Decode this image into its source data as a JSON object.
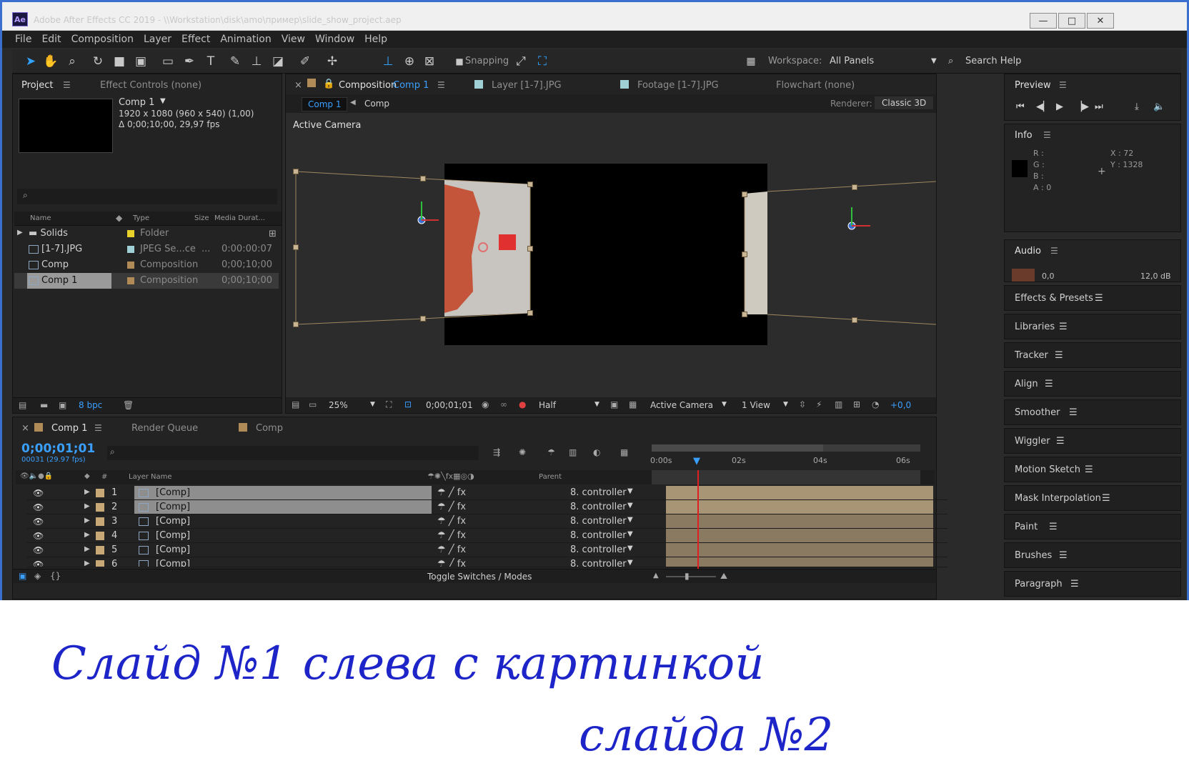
{
  "window": {
    "app_icon": "Ae",
    "title": "Adobe After Effects CC 2019 - \\\\Workstation\\disk\\amo\\пример\\slide_show_project.aep",
    "buttons": {
      "minimize": "—",
      "maximize": "□",
      "close": "✕"
    }
  },
  "menu": [
    "File",
    "Edit",
    "Composition",
    "Layer",
    "Effect",
    "Animation",
    "View",
    "Window",
    "Help"
  ],
  "toolbar": {
    "snapping_label": "Snapping",
    "workspace_label": "Workspace:",
    "workspace_value": "All Panels",
    "search_help": "Search Help"
  },
  "project_panel": {
    "tab_project": "Project",
    "tab_effect_controls": "Effect Controls (none)",
    "selected_name": "Comp 1",
    "selected_dims": "1920 x 1080  (960 x 540) (1,00)",
    "selected_duration": "Δ 0;00;10;00, 29,97 fps",
    "columns": {
      "name": "Name",
      "type": "Type",
      "size": "Size",
      "duration": "Media Durat..."
    },
    "items": [
      {
        "name": "Solids",
        "type": "Folder",
        "duration": "",
        "color": "#e8d12a"
      },
      {
        "name": "[1-7].JPG",
        "type": "JPEG Se...ce",
        "size": "...",
        "duration": "0:00:00:07",
        "color": "#9fd0d6"
      },
      {
        "name": "Comp",
        "type": "Composition",
        "duration": "0;00;10;00",
        "color": "#b08a57"
      },
      {
        "name": "Comp 1",
        "type": "Composition",
        "duration": "0;00;10;00",
        "color": "#b08a57"
      }
    ],
    "bpc": "8 bpc"
  },
  "comp_panel": {
    "tab_composition_prefix": "Composition",
    "tab_composition_name": "Comp 1",
    "tab_layer": "Layer [1-7].JPG",
    "tab_footage": "Footage [1-7].JPG",
    "tab_flowchart": "Flowchart (none)",
    "crumb_active": "Comp 1",
    "crumb_next": "Comp",
    "renderer_label": "Renderer:",
    "renderer_value": "Classic 3D",
    "view_label": "Active Camera",
    "footer": {
      "zoom": "25%",
      "timecode": "0;00;01;01",
      "resolution": "Half",
      "camera": "Active Camera",
      "views": "1 View",
      "exposure": "+0,0"
    }
  },
  "right_panels": {
    "preview": "Preview",
    "info": "Info",
    "info_values": {
      "r": "R :",
      "g": "G :",
      "b": "B :",
      "a": "A : 0",
      "x": "X : 72",
      "y": "Y : 1328"
    },
    "audio": "Audio",
    "audio_left": "0,0",
    "audio_right": "12,0 dB",
    "stack": [
      "Effects & Presets",
      "Libraries",
      "Tracker",
      "Align",
      "Smoother",
      "Wiggler",
      "Motion Sketch",
      "Mask Interpolation",
      "Paint",
      "Brushes",
      "Paragraph"
    ]
  },
  "timeline": {
    "tab_comp1": "Comp 1",
    "tab_render_queue": "Render Queue",
    "tab_comp": "Comp",
    "timecode": "0;00;01;01",
    "frame_info": "00031 (29.97 fps)",
    "col_num": "#",
    "col_layer_name": "Layer Name",
    "col_parent": "Parent",
    "ruler": [
      "0:00s",
      "02s",
      "04s",
      "06s"
    ],
    "layers": [
      {
        "num": "1",
        "name": "[Comp]",
        "parent": "8. controller",
        "selected": true
      },
      {
        "num": "2",
        "name": "[Comp]",
        "parent": "8. controller",
        "selected": true
      },
      {
        "num": "3",
        "name": "[Comp]",
        "parent": "8. controller",
        "selected": false
      },
      {
        "num": "4",
        "name": "[Comp]",
        "parent": "8. controller",
        "selected": false
      },
      {
        "num": "5",
        "name": "[Comp]",
        "parent": "8. controller",
        "selected": false
      },
      {
        "num": "6",
        "name": "[Comp]",
        "parent": "8. controller",
        "selected": false
      }
    ],
    "toggle_label": "Toggle Switches / Modes"
  },
  "handwriting": {
    "line1": "Слайд №1 слева с картинкой",
    "line2": "слайда №2",
    "color": "#1d24c8"
  }
}
